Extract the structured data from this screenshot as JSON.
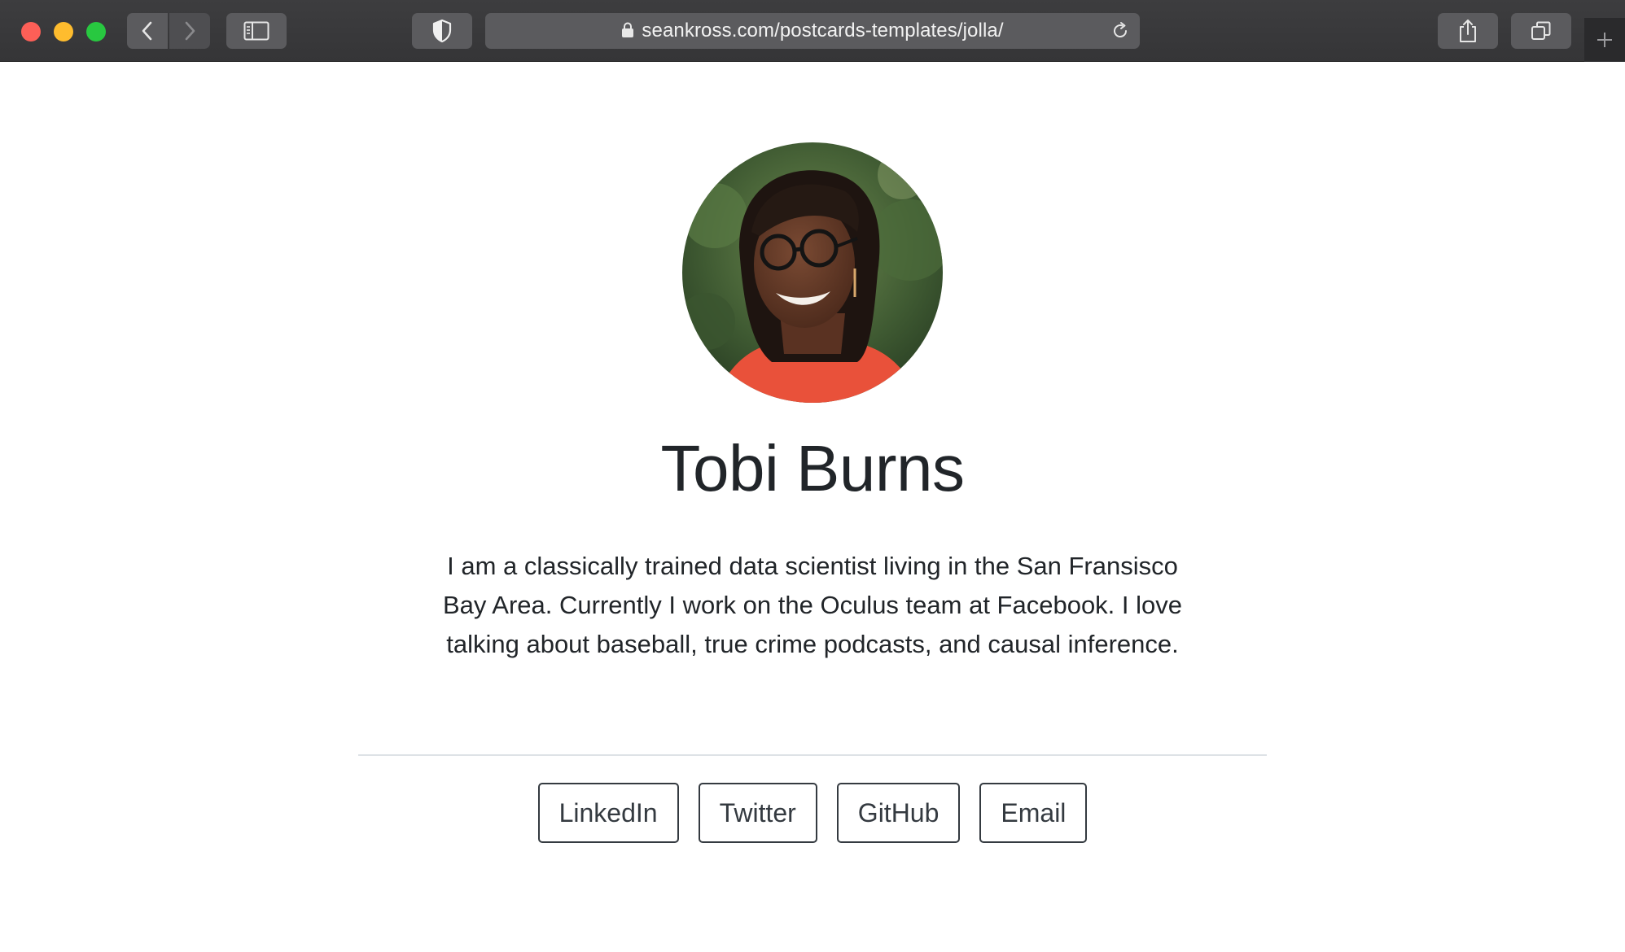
{
  "browser": {
    "url": "seankross.com/postcards-templates/jolla/",
    "icons": {
      "back": "chevron-left-icon",
      "forward": "chevron-right-icon",
      "sidebar": "sidebar-icon",
      "privacy": "shield-icon",
      "lock": "lock-icon",
      "reload": "reload-icon",
      "share": "share-icon",
      "tabs": "tabs-overview-icon",
      "new_tab": "plus-icon"
    },
    "colors": {
      "close": "#fd5f57",
      "minimize": "#febc2e",
      "maximize": "#28c840",
      "toolbar": "#3a3a3c"
    }
  },
  "profile": {
    "name": "Tobi Burns",
    "bio": "I am a classically trained data scientist living in the San Fransisco Bay Area. Currently I work on the Oculus team at Facebook. I love talking about baseball, true crime podcasts, and causal inference."
  },
  "links": [
    {
      "label": "LinkedIn"
    },
    {
      "label": "Twitter"
    },
    {
      "label": "GitHub"
    },
    {
      "label": "Email"
    }
  ]
}
